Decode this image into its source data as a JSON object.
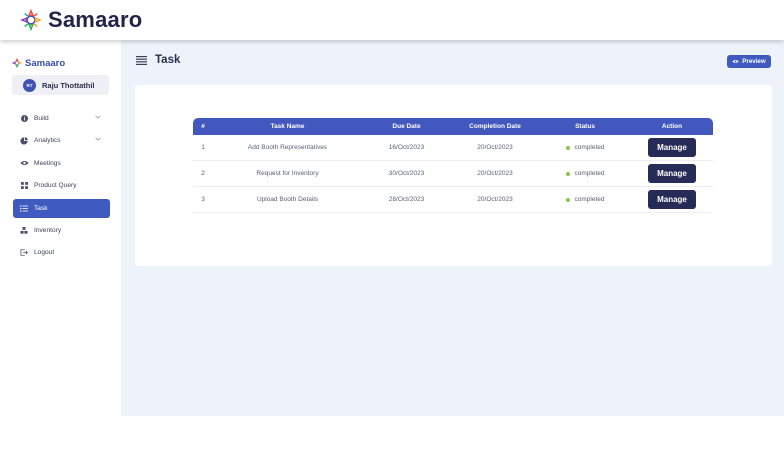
{
  "app": {
    "brand_name": "Samaaro",
    "logo_icon": "samaaro-logo-icon"
  },
  "sidebar": {
    "brand_name": "Samaaro",
    "user": {
      "initials": "RT",
      "name": "Raju Thottathil"
    },
    "items": [
      {
        "label": "Build",
        "icon": "info-icon",
        "has_chevron": true,
        "active": false
      },
      {
        "label": "Analytics",
        "icon": "pie-chart-icon",
        "has_chevron": true,
        "active": false
      },
      {
        "label": "Meetings",
        "icon": "eye-icon",
        "has_chevron": false,
        "active": false
      },
      {
        "label": "Product Query",
        "icon": "grid-icon",
        "has_chevron": false,
        "active": false
      },
      {
        "label": "Task",
        "icon": "list-icon",
        "has_chevron": false,
        "active": true
      },
      {
        "label": "Inventory",
        "icon": "boxes-icon",
        "has_chevron": false,
        "active": false
      },
      {
        "label": "Logout",
        "icon": "logout-icon",
        "has_chevron": false,
        "active": false
      }
    ]
  },
  "main": {
    "title": "Task",
    "preview_label": "Preview"
  },
  "table": {
    "headers": [
      "#",
      "Task Name",
      "Due Date",
      "Completion Date",
      "Status",
      "Action"
    ],
    "rows": [
      {
        "num": "1",
        "task_name": "Add Booth Representatives",
        "due_date": "16/Oct/2023",
        "completion_date": "20/Oct/2023",
        "status": "completed",
        "action": "Manage"
      },
      {
        "num": "2",
        "task_name": "Request for Inventory",
        "due_date": "30/Oct/2023",
        "completion_date": "20/Oct/2023",
        "status": "completed",
        "action": "Manage"
      },
      {
        "num": "3",
        "task_name": "Upload Booth Details",
        "due_date": "28/Oct/2023",
        "completion_date": "20/Oct/2023",
        "status": "completed",
        "action": "Manage"
      }
    ]
  },
  "colors": {
    "primary": "#3f5bbf",
    "table_header": "#4258be",
    "manage_button": "#272b57",
    "status_completed": "#8bc34a",
    "main_background": "#eef3fb"
  }
}
